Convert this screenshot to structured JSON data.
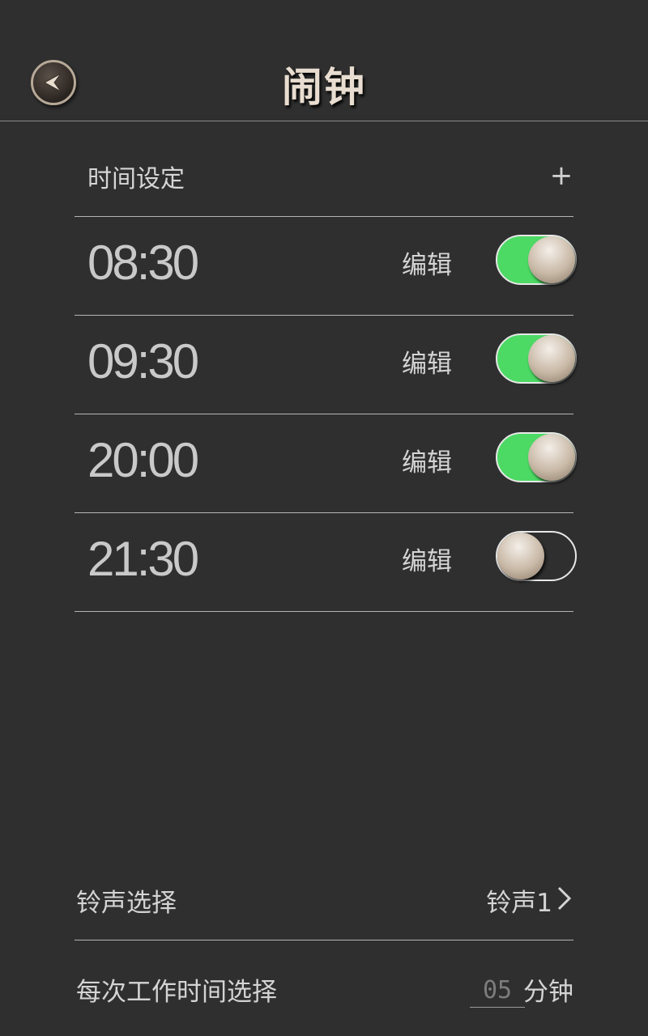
{
  "header": {
    "title": "闹钟",
    "back_icon": "back-arrow-icon"
  },
  "section": {
    "label": "时间设定",
    "add_label": "+"
  },
  "alarms": [
    {
      "time": "08:30",
      "edit_label": "编辑",
      "enabled": true
    },
    {
      "time": "09:30",
      "edit_label": "编辑",
      "enabled": true
    },
    {
      "time": "20:00",
      "edit_label": "编辑",
      "enabled": true
    },
    {
      "time": "21:30",
      "edit_label": "编辑",
      "enabled": false
    }
  ],
  "ringtone": {
    "label": "铃声选择",
    "value": "铃声1",
    "icon": "chevron-right-icon"
  },
  "interval": {
    "label": "每次工作时间选择",
    "value": "05",
    "unit": "分钟"
  },
  "colors": {
    "background": "#2f2f2f",
    "toggle_on": "#4cd964",
    "text": "#d4d4d4"
  }
}
